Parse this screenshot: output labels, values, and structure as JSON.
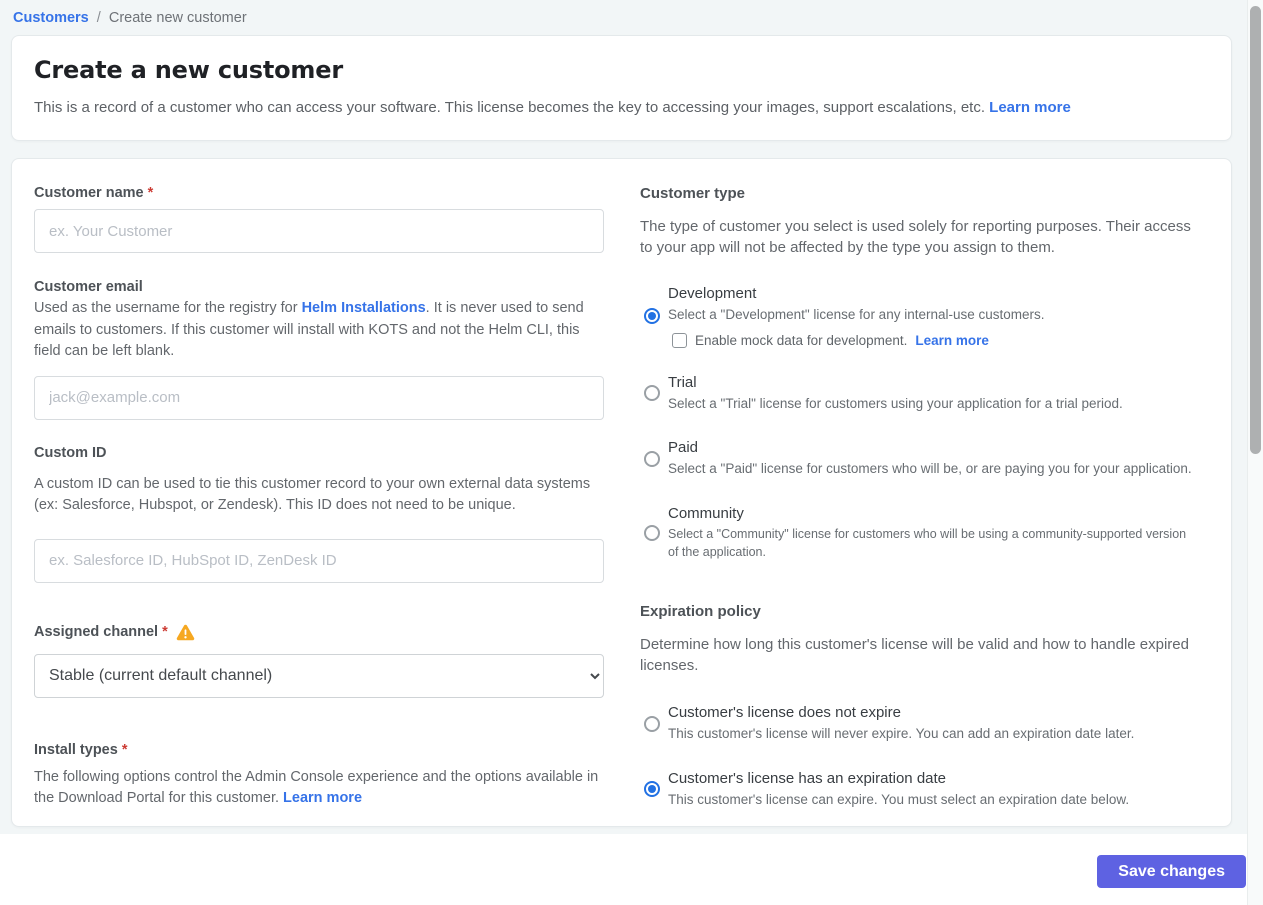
{
  "breadcrumb": {
    "link": "Customers",
    "separator": "/",
    "current": "Create new customer"
  },
  "header": {
    "title": "Create a new customer",
    "description": "This is a record of a customer who can access your software. This license becomes the key to accessing your images, support escalations, etc.",
    "learn_more": "Learn more"
  },
  "form": {
    "customer_name": {
      "label": "Customer name",
      "required": "*",
      "placeholder": "ex. Your Customer",
      "value": ""
    },
    "customer_email": {
      "label": "Customer email",
      "desc_before": "Used as the username for the registry for ",
      "desc_link": "Helm Installations",
      "desc_after": ". It is never used to send emails to customers. If this customer will install with KOTS and not the Helm CLI, this field can be left blank.",
      "placeholder": "jack@example.com",
      "value": ""
    },
    "custom_id": {
      "label": "Custom ID",
      "description": "A custom ID can be used to tie this customer record to your own external data systems (ex: Salesforce, Hubspot, or Zendesk). This ID does not need to be unique.",
      "placeholder": "ex. Salesforce ID, HubSpot ID, ZenDesk ID",
      "value": ""
    },
    "assigned_channel": {
      "label": "Assigned channel",
      "required": "*",
      "selected_option": "Stable (current default channel)",
      "has_warning": true
    },
    "install_types": {
      "label": "Install types",
      "required": "*",
      "description": "The following options control the Admin Console experience and the options available in the Download Portal for this customer.",
      "learn_more": "Learn more"
    }
  },
  "customer_type": {
    "label": "Customer type",
    "description": "The type of customer you select is used solely for reporting purposes. Their access to your app will not be affected by the type you assign to them.",
    "options": [
      {
        "title": "Development",
        "description": "Select a \"Development\" license for any internal-use customers.",
        "selected": true,
        "checkbox": {
          "label": "Enable mock data for development.",
          "learn_more": "Learn more",
          "checked": false
        }
      },
      {
        "title": "Trial",
        "description": "Select a \"Trial\" license for customers using your application for a trial period.",
        "selected": false
      },
      {
        "title": "Paid",
        "description": "Select a \"Paid\" license for customers who will be, or are paying you for your application.",
        "selected": false
      },
      {
        "title": "Community",
        "description": "Select a \"Community\" license for customers who will be using a community-supported version of the application.",
        "selected": false
      }
    ]
  },
  "expiration_policy": {
    "label": "Expiration policy",
    "description": "Determine how long this customer's license will be valid and how to handle expired licenses.",
    "options": [
      {
        "title": "Customer's license does not expire",
        "description": "This customer's license will never expire. You can add an expiration date later.",
        "selected": false
      },
      {
        "title": "Customer's license has an expiration date",
        "description": "This customer's license can expire. You must select an expiration date below.",
        "selected": true
      }
    ]
  },
  "footer": {
    "save_button": "Save changes"
  },
  "colors": {
    "accent_link_blue": "#3673e8",
    "radio_selected_blue": "#2271e3",
    "save_button_indigo": "#5e62e2",
    "warning_amber": "#f6a821",
    "required_red": "#cc3b33",
    "page_background": "#f2f6f7"
  }
}
